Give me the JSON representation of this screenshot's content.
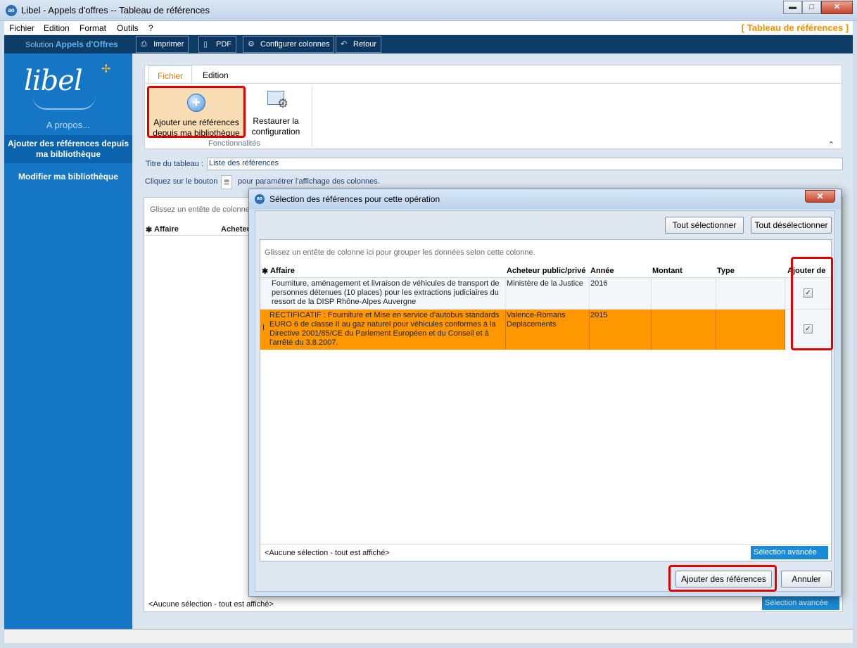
{
  "window": {
    "title": "Libel - Appels d'offres -- Tableau de références",
    "minimize": "▬",
    "maximize": "□",
    "close": "✕"
  },
  "menu": {
    "items": [
      "Fichier",
      "Edition",
      "Format",
      "Outils",
      "?"
    ],
    "app_label": "[ Tableau de références ]"
  },
  "toolbar": {
    "solution": "Solution",
    "product": "Appels d'Offres",
    "buttons": [
      {
        "label": "Imprimer",
        "icon": "printer-icon"
      },
      {
        "label": "PDF",
        "icon": "pdf-icon"
      },
      {
        "label": "Configurer colonnes",
        "icon": "gears-icon"
      },
      {
        "label": "Retour",
        "icon": "return-arrow-icon"
      }
    ]
  },
  "sidebar": {
    "logo": "libel",
    "apropos": "A propos...",
    "items": [
      {
        "label": "Ajouter des références depuis ma bibliothèque"
      },
      {
        "label": "Modifier ma bibliothèque"
      }
    ]
  },
  "ribbon": {
    "tabs": [
      "Fichier",
      "Edition"
    ],
    "add_button": "Ajouter une références depuis ma bibliothèque",
    "restore_button": "Restaurer la configuration",
    "group_label": "Fonctionnalités"
  },
  "form": {
    "title_label": "Titre du tableau :",
    "title_value": "Liste des références",
    "hint_before": "Cliquez sur le bouton",
    "hint_after": "pour paramétrer l'affichage des colonnes."
  },
  "background_grid": {
    "drag_hint": "Glissez un entête de colonne",
    "col_affaire": "Affaire",
    "col_acheteur": "Acheteu",
    "footer": "<Aucune sélection - tout est affiché>",
    "advanced": "Sélection avancée ..."
  },
  "dialog": {
    "title": "Sélection des références pour cette opération",
    "select_all": "Tout sélectionner",
    "deselect_all": "Tout désélectionner",
    "drag_hint": "Glissez un entête de colonne ici pour grouper les données selon cette colonne.",
    "columns": [
      "Affaire",
      "Acheteur public/privé",
      "Année",
      "Montant",
      "Type",
      "Ajouter de"
    ],
    "rows": [
      {
        "affaire": "Fourniture, aménagement et livraison de véhicules de transport de personnes détenues (10 places) pour les extractions judiciaires du ressort de la DISP Rhône-Alpes Auvergne",
        "acheteur": "Ministère de la Justice",
        "annee": "2016",
        "montant": "",
        "type": "",
        "checked": "✓"
      },
      {
        "affaire": "RECTIFICATIF : Fourniture et Mise en service d'autobus standards EURO 6 de classe II au gaz naturel pour véhicules conformes à la Directive 2001/85/CE du Parlement Européen et du Conseil et à l'arrêté du 3.8.2007.",
        "acheteur": "Valence-Romans Deplacements",
        "annee": "2015",
        "montant": "",
        "type": "",
        "checked": "✓"
      }
    ],
    "footer": "<Aucune sélection - tout est affiché>",
    "advanced": "Sélection avancée ...",
    "add_button": "Ajouter des références",
    "cancel_button": "Annuler"
  },
  "colors": {
    "accent_orange": "#f39200",
    "sidebar_blue": "#1576c6",
    "toolbar_navy": "#0e3d68",
    "selected_row": "#ff9800",
    "highlight_red": "#e00000"
  }
}
